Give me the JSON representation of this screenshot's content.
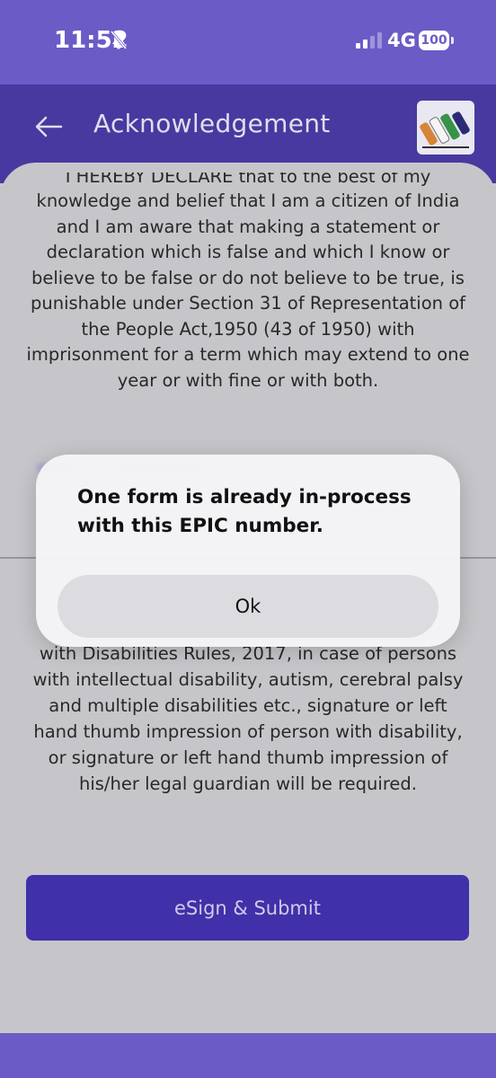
{
  "status_bar": {
    "time": "11:52",
    "network": "4G",
    "battery": "100"
  },
  "header": {
    "title": "Acknowledgement"
  },
  "declaration": {
    "cut_line": "I HEREBY DECLARE that to the best of my",
    "text": "knowledge and belief that I am a citizen of India and I am aware that making a statement or declaration which is false and which I know or believe to be false or do not believe to be true, is punishable under Section 31 of Representation of the People Act,1950 (43 of 1950) with imprisonment for a term which may extend to one year or with fine or with both."
  },
  "disability_note": {
    "text": "with Disabilities Rules, 2017, in case of persons with intellectual disability, autism, cerebral palsy and multiple disabilities etc., signature or left hand thumb impression of person with disability, or signature or left hand thumb impression of his/her legal guardian will be required."
  },
  "submit_label": "eSign & Submit",
  "dialog": {
    "message": "One form is already in-process with this EPIC number.",
    "ok_label": "Ok"
  },
  "colors": {
    "header": "#4a3ca7",
    "status_bar": "#6b5bc6",
    "button": "#4332b0"
  }
}
